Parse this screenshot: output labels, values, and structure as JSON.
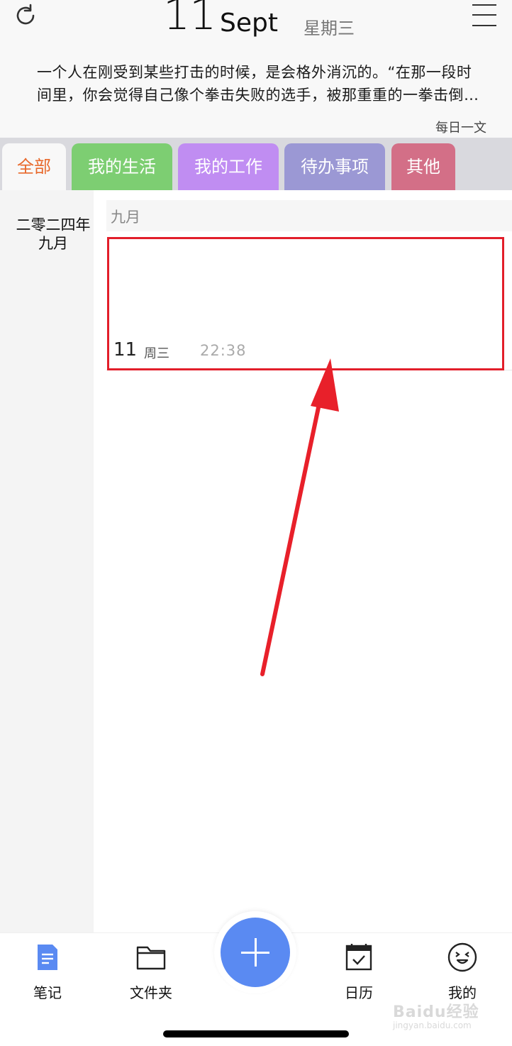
{
  "header": {
    "day": "11",
    "month": "Sept",
    "weekday": "星期三",
    "quote_line1": "一个人在刚受到某些打击的时候，是会格外消沉的。“在那一段时",
    "quote_line2": "间里，你会觉得自己像个拳击失败的选手，被那重重的一拳击倒…",
    "daily_label": "每日一文"
  },
  "tabs": [
    {
      "label": "全部",
      "color": "#f8f8f8",
      "active": true
    },
    {
      "label": "我的生活",
      "color": "#7dce72"
    },
    {
      "label": "我的工作",
      "color": "#c08df2"
    },
    {
      "label": "待办事项",
      "color": "#9b98d4"
    },
    {
      "label": "其他",
      "color": "#d36f87"
    }
  ],
  "sidebar": {
    "year": "二零二四年",
    "month": "九月"
  },
  "notes": {
    "section_title": "九月",
    "items": [
      {
        "day": "11",
        "weekday": "周三",
        "time": "22:38"
      }
    ]
  },
  "bottom_nav": [
    {
      "label": "笔记",
      "icon": "note-icon",
      "active": true
    },
    {
      "label": "文件夹",
      "icon": "folder-icon"
    },
    {
      "label": "日历",
      "icon": "calendar-icon"
    },
    {
      "label": "我的",
      "icon": "face-icon"
    }
  ],
  "watermark": {
    "main": "Baidu经验",
    "sub": "jingyan.baidu.com"
  },
  "colors": {
    "accent": "#e8692c",
    "fab": "#5a8af2",
    "annotation": "#e21e2a"
  }
}
